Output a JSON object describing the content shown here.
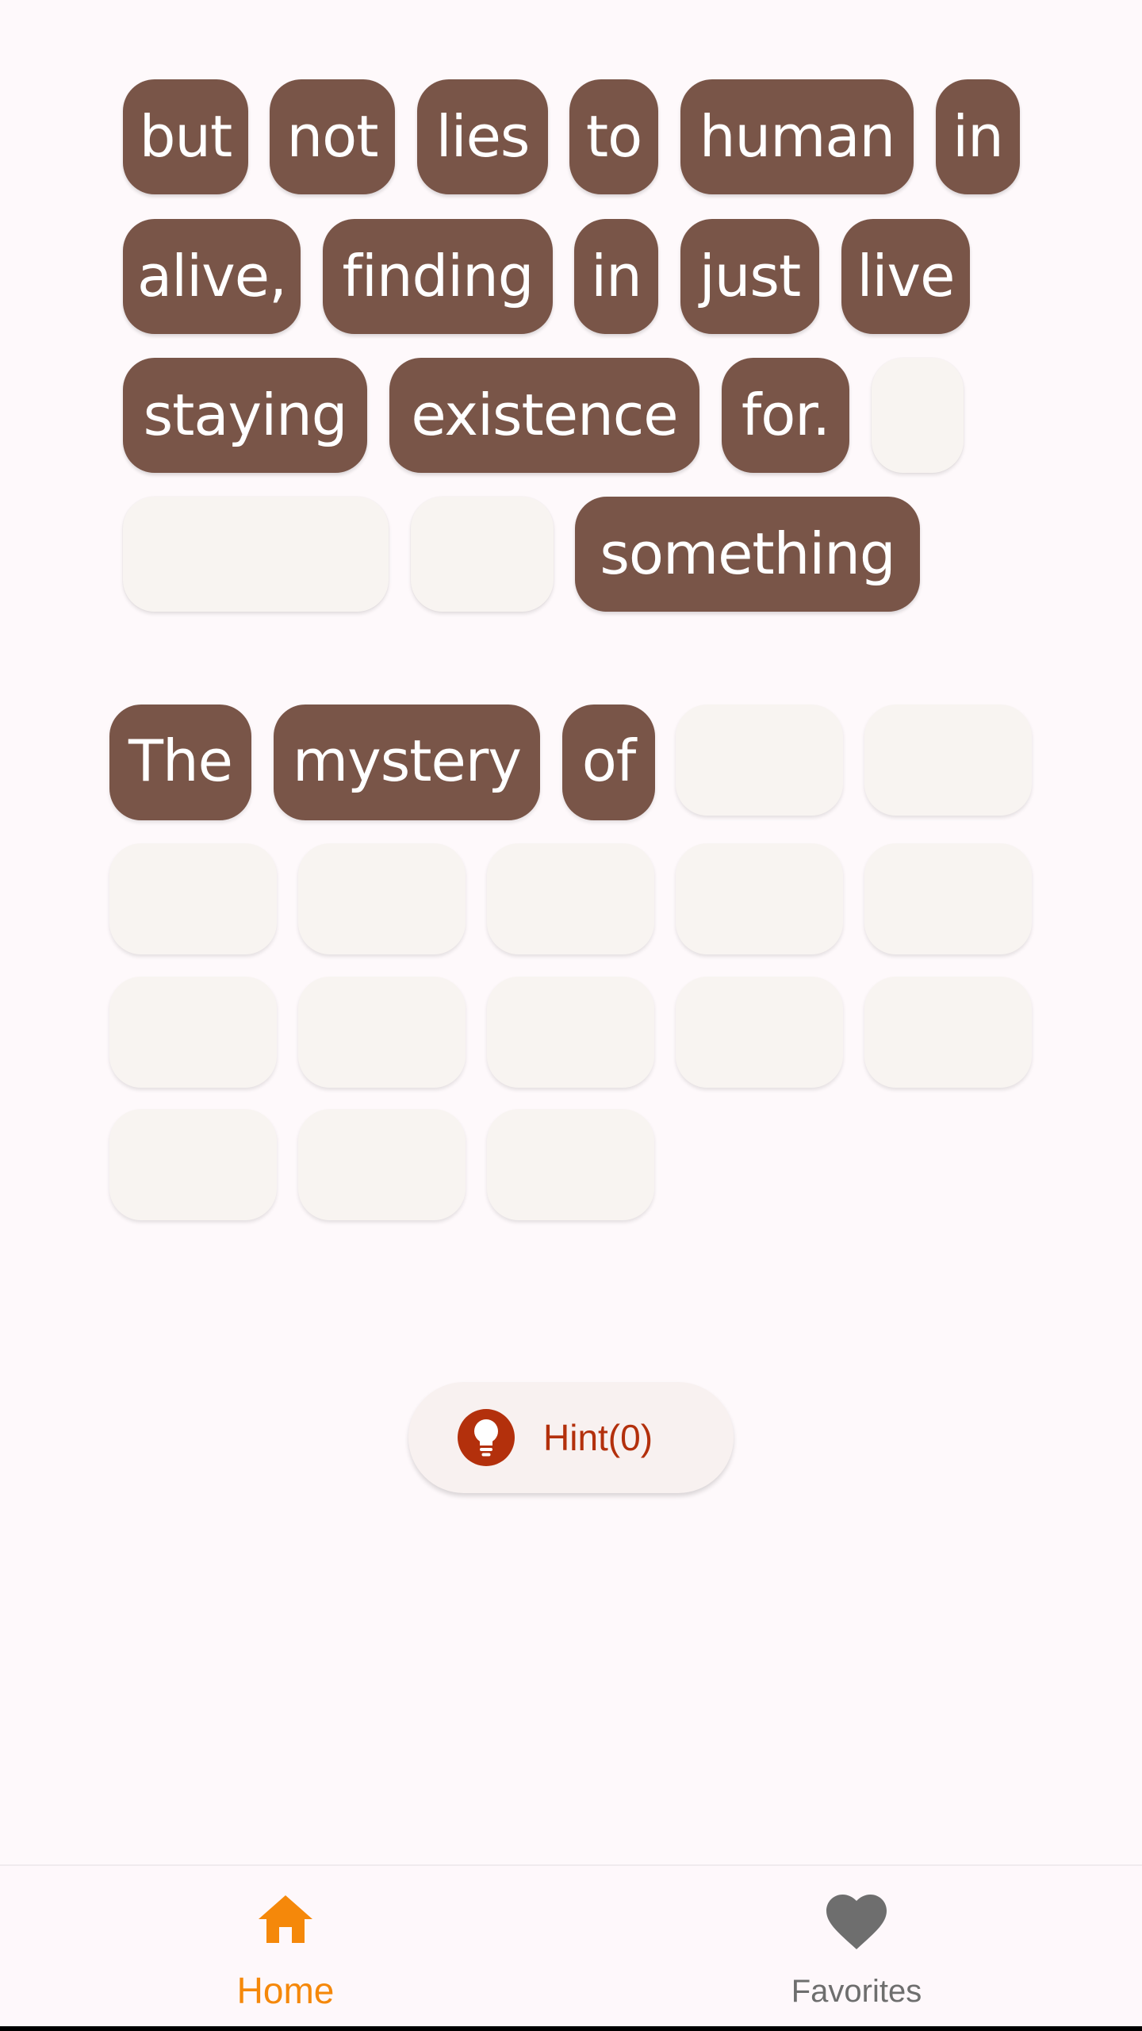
{
  "word_bank": [
    {
      "text": "but"
    },
    {
      "text": "not"
    },
    {
      "text": "lies"
    },
    {
      "text": "to"
    },
    {
      "text": "human"
    },
    {
      "text": "in"
    },
    {
      "text": "alive,"
    },
    {
      "text": "finding"
    },
    {
      "text": "in"
    },
    {
      "text": "just"
    },
    {
      "text": "live"
    },
    {
      "text": "staying"
    },
    {
      "text": "existence"
    },
    {
      "text": "for."
    },
    {
      "text": ""
    },
    {
      "text": ""
    },
    {
      "text": ""
    },
    {
      "text": "something"
    }
  ],
  "answer_slots": [
    {
      "text": "The"
    },
    {
      "text": "mystery"
    },
    {
      "text": "of"
    },
    {
      "text": ""
    },
    {
      "text": ""
    },
    {
      "text": ""
    },
    {
      "text": ""
    },
    {
      "text": ""
    },
    {
      "text": ""
    },
    {
      "text": ""
    },
    {
      "text": ""
    },
    {
      "text": ""
    },
    {
      "text": ""
    },
    {
      "text": ""
    },
    {
      "text": ""
    },
    {
      "text": ""
    },
    {
      "text": ""
    },
    {
      "text": ""
    }
  ],
  "hint": {
    "label": "Hint(0)",
    "icon": "lightbulb-icon",
    "color": "#b3300c"
  },
  "nav": {
    "items": [
      {
        "label": "Home",
        "icon": "home-icon",
        "active": true,
        "color": "#f5880a"
      },
      {
        "label": "Favorites",
        "icon": "heart-icon",
        "active": false,
        "color": "#6e6e6e"
      }
    ]
  },
  "colors": {
    "chip": "#795548",
    "chip_text": "#ffffff",
    "empty_slot": "#f8f4f1",
    "background": "#fef9fb"
  }
}
